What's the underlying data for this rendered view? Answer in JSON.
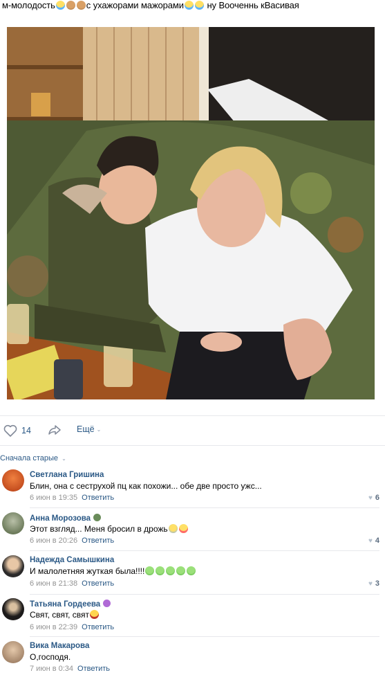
{
  "post": {
    "caption_parts": [
      "м-молодость",
      "с ухажорами мажорами",
      " ну Вооченнь кВасивая"
    ],
    "caption_emojis": [
      "laughing-tears",
      "see-no-evil-monkey",
      "see-no-evil-monkey",
      "laughing-tears",
      "laughing-tears"
    ]
  },
  "actions": {
    "like_count": "14",
    "more_label": "Ещё"
  },
  "comments_sort": {
    "label": "Сначала старые"
  },
  "comments": [
    {
      "name": "Светлана Гришина",
      "text": "Блин, она с сеструхой пц как похожи... обе две просто ужс...",
      "date": "6 июн в 19:35",
      "reply": "Ответить",
      "likes": "6"
    },
    {
      "name": "Анна Морозова",
      "text": "Этот взгляд... Меня бросил в дрожь",
      "date": "6 июн в 20:26",
      "reply": "Ответить",
      "likes": "4"
    },
    {
      "name": "Надежда Самышкина",
      "text": "И малолетняя жуткая была!!!!",
      "date": "6 июн в 21:38",
      "reply": "Ответить",
      "likes": "3"
    },
    {
      "name": "Татьяна Гордеева",
      "text": "Свят, свят, свят",
      "date": "6 июн в 22:39",
      "reply": "Ответить",
      "likes": ""
    },
    {
      "name": "Вика Макарова",
      "text": "О,господя.",
      "date": "7 июн в 0:34",
      "reply": "Ответить",
      "likes": ""
    }
  ],
  "colors": {
    "link": "#2a5885",
    "meta": "#939393",
    "divider": "#e7e8ec"
  }
}
